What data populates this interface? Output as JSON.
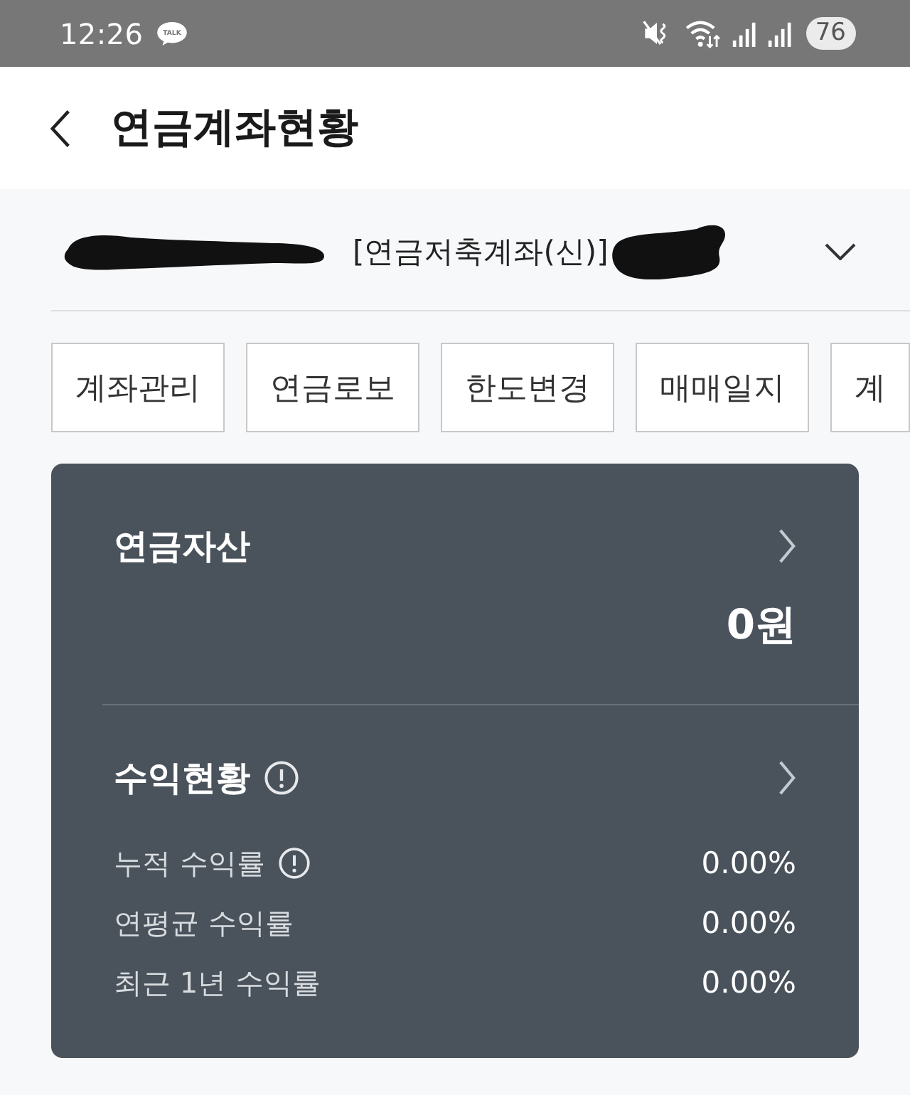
{
  "status_bar": {
    "time": "12:26",
    "notification_badge": "TALK",
    "battery": "76"
  },
  "header": {
    "title": "연금계좌현황"
  },
  "account": {
    "type": "[연금저축계좌(신)]"
  },
  "tabs": [
    "계좌관리",
    "연금로보",
    "한도변경",
    "매매일지",
    "계"
  ],
  "asset": {
    "title": "연금자산",
    "amount": "0원"
  },
  "returns": {
    "title": "수익현황",
    "info": true,
    "rows": [
      {
        "label": "누적 수익률",
        "info": true,
        "value": "0.00%"
      },
      {
        "label": "연평균 수익률",
        "info": false,
        "value": "0.00%"
      },
      {
        "label": "최근 1년 수익률",
        "info": false,
        "value": "0.00%"
      }
    ]
  }
}
